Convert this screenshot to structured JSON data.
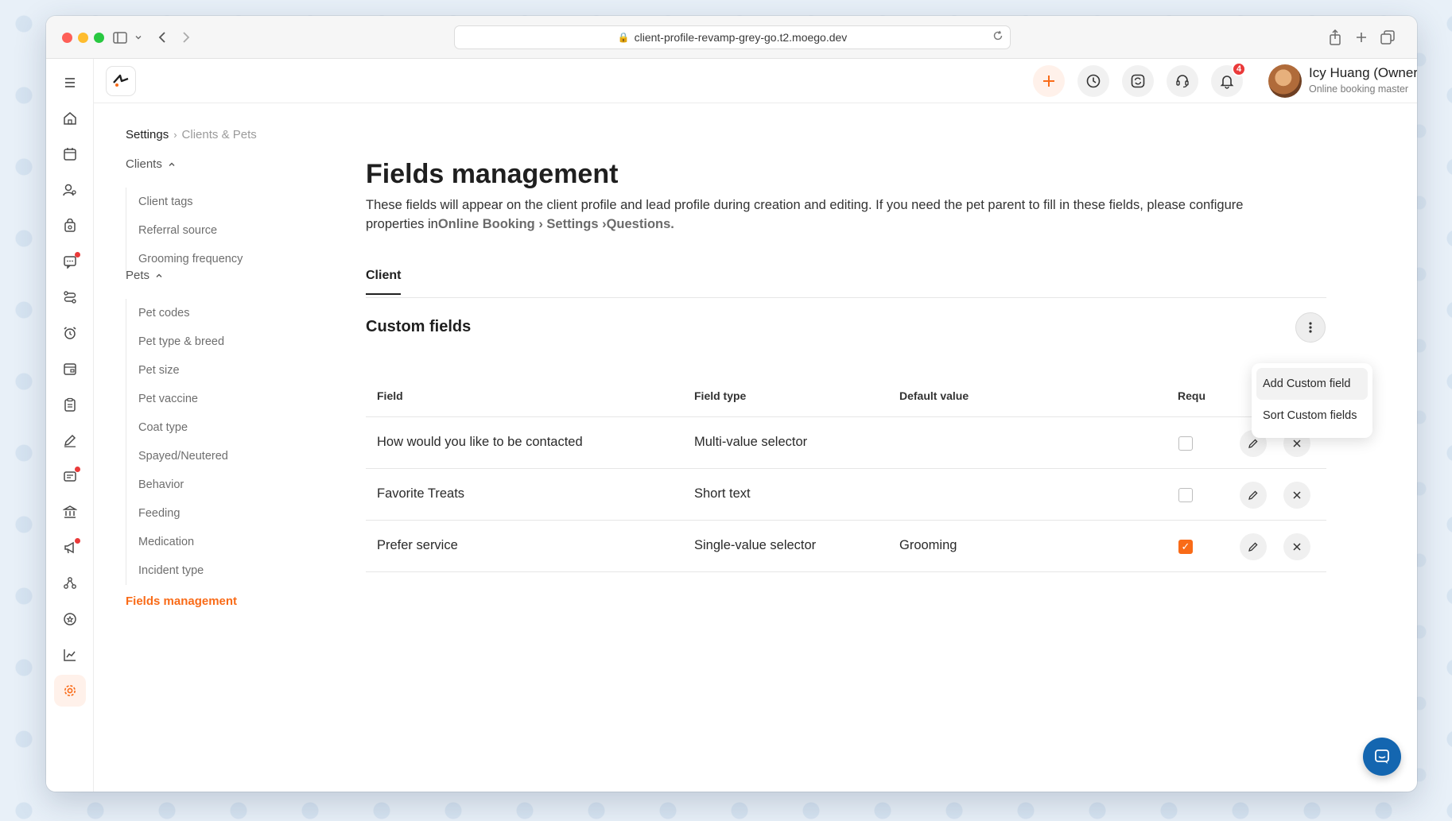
{
  "browser": {
    "url": "client-profile-revamp-grey-go.t2.moego.dev"
  },
  "header": {
    "user_name": "Icy Huang (Owner)",
    "user_role": "Online booking master",
    "notification_count": "4"
  },
  "breadcrumb": {
    "root": "Settings",
    "current": "Clients & Pets"
  },
  "settings_nav": {
    "clients_group": "Clients",
    "clients_items": [
      "Client tags",
      "Referral source",
      "Grooming frequency"
    ],
    "pets_group": "Pets",
    "pets_items": [
      "Pet codes",
      "Pet type & breed",
      "Pet size",
      "Pet vaccine",
      "Coat type",
      "Spayed/Neutered",
      "Behavior",
      "Feeding",
      "Medication",
      "Incident type"
    ],
    "active_item": "Fields management"
  },
  "main": {
    "title": "Fields management",
    "description": "These fields will appear on the client profile and lead profile during creation and editing. If you need the pet parent to fill in these fields, please configure properties in",
    "path_online_booking": "Online Booking",
    "path_settings": "Settings",
    "path_questions": "Questions.",
    "tab_client": "Client",
    "section_title": "Custom fields"
  },
  "table": {
    "headers": {
      "field": "Field",
      "field_type": "Field type",
      "default_value": "Default value",
      "required": "Requ"
    },
    "rows": [
      {
        "field": "How would you like to be contacted",
        "field_type": "Multi-value selector",
        "default_value": "",
        "required": false
      },
      {
        "field": "Favorite Treats",
        "field_type": "Short text",
        "default_value": "",
        "required": true
      },
      {
        "field": "Prefer service",
        "field_type": "Single-value selector",
        "default_value": "Grooming",
        "required": true
      }
    ]
  },
  "dropdown": {
    "add_label": "Add Custom field",
    "sort_label": "Sort Custom fields"
  },
  "colors": {
    "accent": "#f96b18",
    "chat": "#1466b0",
    "badge": "#ea3a3a"
  }
}
